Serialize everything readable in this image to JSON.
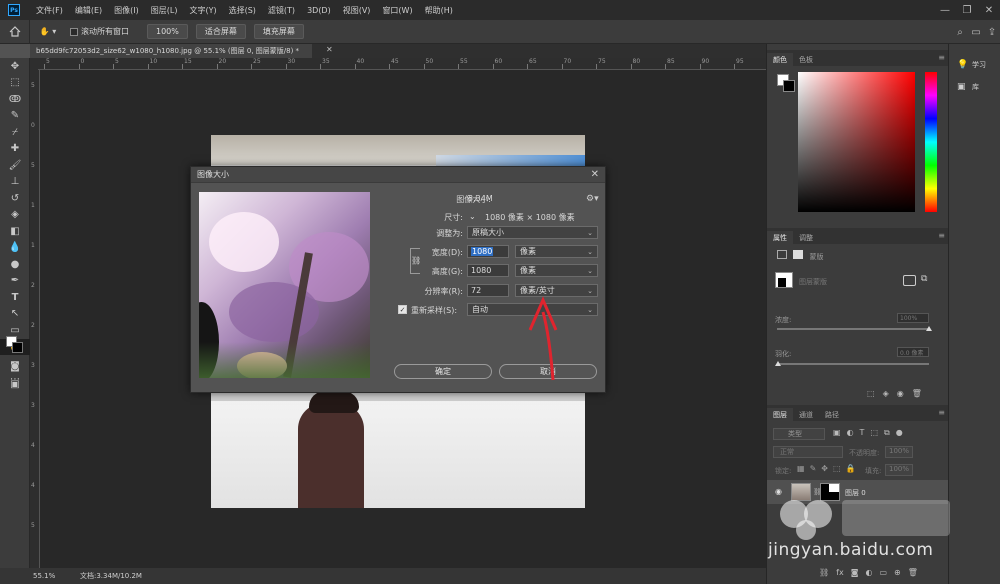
{
  "menu": [
    "文件(F)",
    "编辑(E)",
    "图像(I)",
    "图层(L)",
    "文字(Y)",
    "选择(S)",
    "滤镜(T)",
    "3D(D)",
    "视图(V)",
    "窗口(W)",
    "帮助(H)"
  ],
  "app_logo": "Ps",
  "options": {
    "scroll_all_label": "滚动所有窗口",
    "zoom_value": "100%",
    "fit_screen_label": "适合屏幕",
    "fill_screen_label": "填充屏幕"
  },
  "document": {
    "tab_title": "b65dd9fc72053d2_size62_w1080_h1080.jpg @ 55.1% (图层 0, 图层蒙版/8) *",
    "zoom": "55.1%",
    "doc_size": "文档:3.34M/10.2M"
  },
  "ruler": {
    "h_labels": [
      "5",
      "0",
      "5",
      "10",
      "15",
      "20",
      "25",
      "30",
      "35",
      "40",
      "45",
      "50",
      "55",
      "60",
      "65",
      "70",
      "75",
      "80",
      "85",
      "90",
      "95"
    ],
    "v_labels": [
      "5",
      "0",
      "5",
      "1",
      "1",
      "2",
      "2",
      "3",
      "3",
      "4",
      "4",
      "5"
    ]
  },
  "panels": {
    "color_tabs": [
      "颜色",
      "色板"
    ],
    "props_tabs": [
      "属性",
      "调整"
    ],
    "props_mask": "蒙版",
    "props_layer_mask": "图层蒙版",
    "density_label": "浓度:",
    "density_value": "100%",
    "feather_label": "羽化:",
    "feather_value": "0.0 像素",
    "layers_tabs": [
      "图层",
      "通道",
      "路径"
    ],
    "layer_filter": "类型",
    "blend_mode": "正常",
    "opacity_label": "不透明度:",
    "opacity_value": "100%",
    "lock_label": "锁定:",
    "fill_label": "填充:",
    "fill_value": "100%",
    "layer_name": "图层 0"
  },
  "far_panel": {
    "learn_label": "学习",
    "library_label": "库"
  },
  "dialog": {
    "title": "图像大小",
    "image_size_label": "图像大小:",
    "image_size_value": "3.34M",
    "dimensions_label": "尺寸:",
    "dimensions_value": "1080 像素 × 1080 像素",
    "fit_to_label": "调整为:",
    "fit_to_value": "原稿大小",
    "width_label": "宽度(D):",
    "width_value": "1080",
    "width_unit": "像素",
    "height_label": "高度(G):",
    "height_value": "1080",
    "height_unit": "像素",
    "resolution_label": "分辨率(R):",
    "resolution_value": "72",
    "resolution_unit": "像素/英寸",
    "resample_label": "重新采样(S):",
    "resample_value": "自动",
    "ok_label": "确定",
    "cancel_label": "取消"
  },
  "watermark": {
    "text": "jingyan.baidu.com"
  },
  "colors": {
    "accent": "#31a8ff",
    "selection": "#2f6fc4",
    "annotation_arrow": "#e0242e"
  }
}
